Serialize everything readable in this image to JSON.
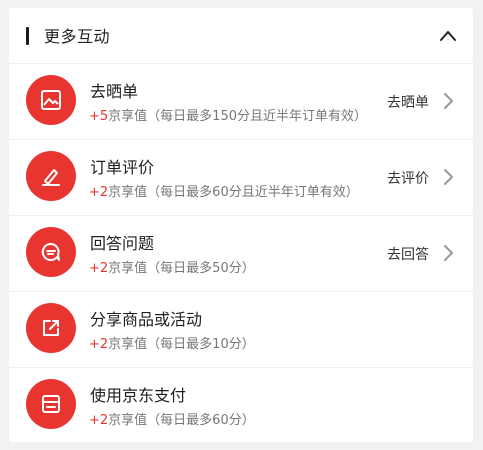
{
  "section": {
    "title": "更多互动"
  },
  "items": [
    {
      "name": "去晒单",
      "plus": "+5",
      "desc": "京享值（每日最多150分且近半年订单有效）",
      "action": "去晒单",
      "icon": "image-icon"
    },
    {
      "name": "订单评价",
      "plus": "+2",
      "desc": "京享值（每日最多60分且近半年订单有效）",
      "action": "去评价",
      "icon": "pen-icon"
    },
    {
      "name": "回答问题",
      "plus": "+2",
      "desc": "京享值（每日最多50分）",
      "action": "去回答",
      "icon": "chat-bubble-icon"
    },
    {
      "name": "分享商品或活动",
      "plus": "+2",
      "desc": "京享值（每日最多10分）",
      "action": "",
      "icon": "share-icon"
    },
    {
      "name": "使用京东支付",
      "plus": "+2",
      "desc": "京享值（每日最多60分）",
      "action": "",
      "icon": "card-icon"
    }
  ],
  "colors": {
    "accent": "#e93530",
    "background": "#f2f2f4",
    "card": "#ffffff"
  }
}
